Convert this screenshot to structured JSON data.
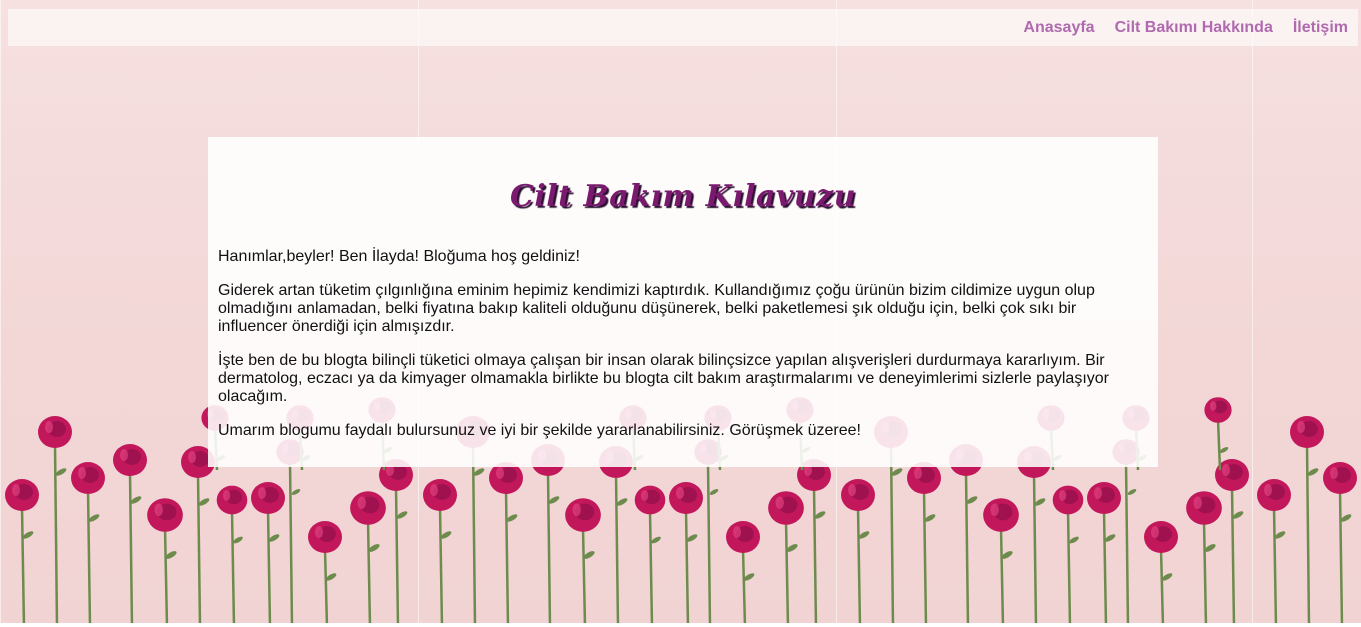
{
  "nav": {
    "items": [
      {
        "label": "Anasayfa"
      },
      {
        "label": "Cilt Bakımı Hakkında"
      },
      {
        "label": "İletişim"
      }
    ]
  },
  "main": {
    "title": "Cilt Bakım Kılavuzu",
    "paragraphs": [
      "Hanımlar,beyler! Ben İlayda! Bloğuma hoş geldiniz!",
      "Giderek artan tüketim çılgınlığına eminim hepimiz kendimizi kaptırdık. Kullandığımız çoğu ürünün bizim cildimize uygun olup olmadığını anlamadan, belki fiyatına bakıp kaliteli olduğunu düşünerek, belki paketlemesi şık olduğu için, belki çok sıkı bir influencer önerdiği için almışızdır.",
      "İşte ben de bu blogta bilinçli tüketici olmaya çalışan bir insan olarak bilinçsizce yapılan alışverişleri durdurmaya kararlıyım. Bir dermatolog, eczacı ya da kimyager olmamakla birlikte bu blogta cilt bakım araştırmalarımı ve deneyimlerimi sizlerle paylaşıyor olacağım.",
      "Umarım blogumu faydalı bulursunuz ve iyi bir şekilde yararlanabilirsiniz. Görüşmek üzeree!"
    ]
  },
  "background": {
    "image": "roses-tile",
    "colors": {
      "pink": "#f3d7d7",
      "rose": "#c2185b",
      "stem": "#6e8b4e"
    }
  },
  "colors": {
    "nav_link": "#b06aaf",
    "title": "#7a1a6e"
  }
}
